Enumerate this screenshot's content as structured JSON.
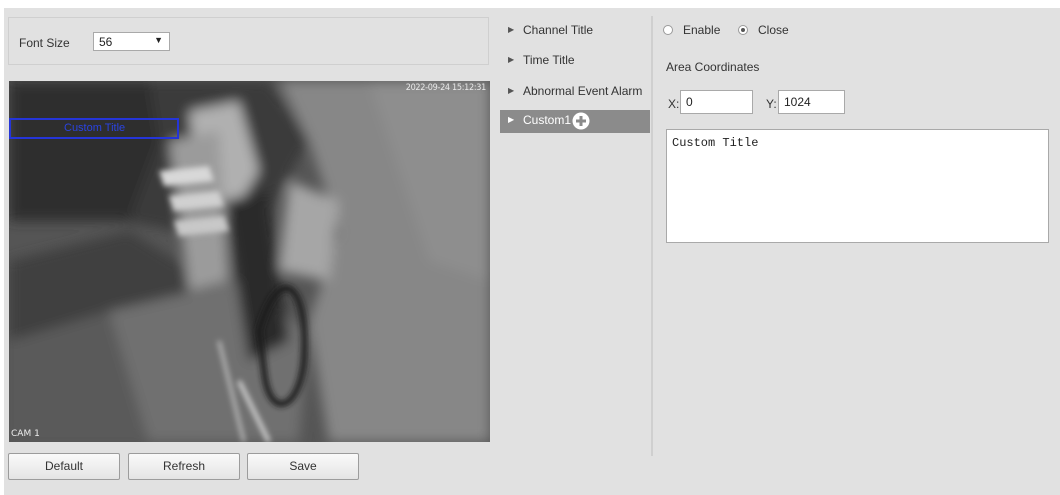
{
  "font_size": {
    "label": "Font Size",
    "value": "56"
  },
  "video": {
    "timestamp": "2022-09-24 15:12:31",
    "camera_label": "CAM 1",
    "overlay_title": "Custom Title"
  },
  "buttons": {
    "default": "Default",
    "refresh": "Refresh",
    "save": "Save"
  },
  "tree": {
    "items": [
      {
        "label": "Channel Title"
      },
      {
        "label": "Time Title"
      },
      {
        "label": "Abnormal Event Alarm"
      },
      {
        "label": "Custom1"
      }
    ],
    "selected_index": 3
  },
  "options": {
    "enable_label": "Enable",
    "close_label": "Close",
    "selected": "Close"
  },
  "area": {
    "label": "Area Coordinates",
    "x_label": "X:",
    "y_label": "Y:",
    "x_value": "0",
    "y_value": "1024"
  },
  "custom_text": "Custom Title",
  "icons": {
    "tree_arrow": "triangle-right-icon",
    "add": "plus-circle-icon"
  },
  "colors": {
    "selected_bg": "#8b8b8b",
    "overlay_box": "#2535d8"
  }
}
